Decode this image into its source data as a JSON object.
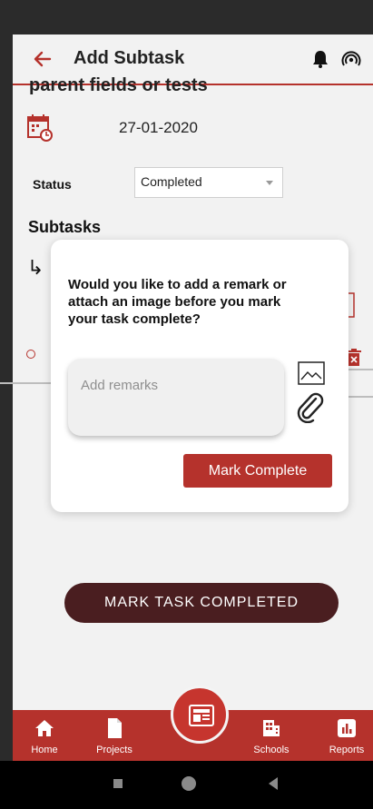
{
  "header": {
    "title": "Add Subtask",
    "back_icon": "arrow-left-icon",
    "notification_icon": "bell-icon",
    "signal_icon": "signal-icon"
  },
  "content": {
    "parent_title_partial": "parent fields or tests",
    "date": "27-01-2020",
    "status_label": "Status",
    "status_value": "Completed",
    "subtasks_heading": "Subtasks",
    "mark_task_completed": "MARK TASK COMPLETED"
  },
  "dialog": {
    "message": "Would you like to add a remark or attach an image before you mark your task complete?",
    "remarks_placeholder": "Add remarks",
    "mark_complete_label": "Mark Complete"
  },
  "nav": {
    "items": [
      {
        "label": "Home",
        "icon": "home-icon"
      },
      {
        "label": "Projects",
        "icon": "document-icon"
      },
      {
        "label": "Schools",
        "icon": "building-icon"
      },
      {
        "label": "Reports",
        "icon": "bar-chart-icon"
      }
    ],
    "fab_icon": "card-icon"
  },
  "colors": {
    "accent": "#b5322c",
    "dark_button": "#4a1e20",
    "background": "#f2f2f2"
  }
}
